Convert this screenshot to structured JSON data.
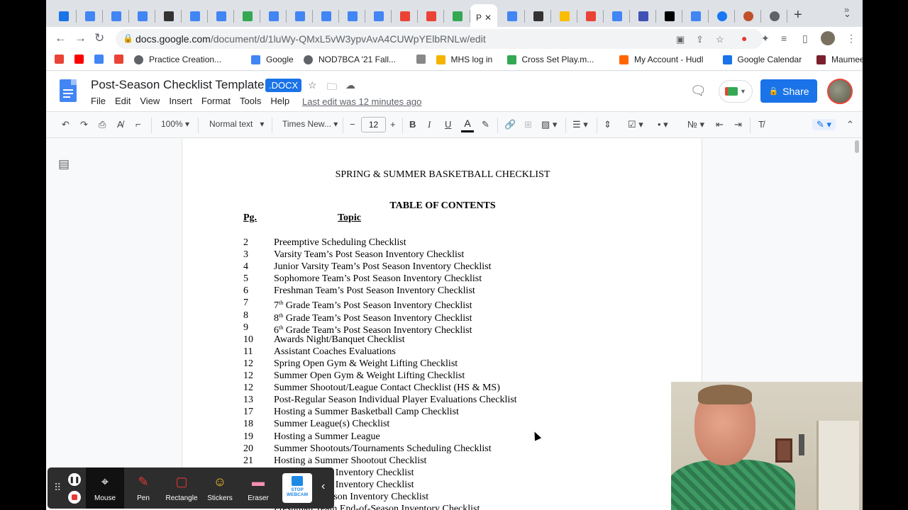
{
  "browser": {
    "tabs": [
      {
        "icon": "calendar-icon",
        "color": "#1a73e8"
      },
      {
        "icon": "docs-icon",
        "color": "#4285f4"
      },
      {
        "icon": "docs-icon",
        "color": "#4285f4"
      },
      {
        "icon": "docs-icon",
        "color": "#4285f4"
      },
      {
        "icon": "owl-icon",
        "color": "#333333"
      },
      {
        "icon": "docs-icon",
        "color": "#4285f4"
      },
      {
        "icon": "docs-icon",
        "color": "#4285f4"
      },
      {
        "icon": "drive-icon",
        "color": "#34a853"
      },
      {
        "icon": "docs-icon",
        "color": "#4285f4"
      },
      {
        "icon": "docs-icon",
        "color": "#4285f4"
      },
      {
        "icon": "docs-icon",
        "color": "#4285f4"
      },
      {
        "icon": "docs-icon",
        "color": "#4285f4"
      },
      {
        "icon": "docs-icon",
        "color": "#4285f4"
      },
      {
        "icon": "gmail-icon",
        "color": "#ea4335"
      },
      {
        "icon": "gmail-icon",
        "color": "#ea4335"
      },
      {
        "icon": "drive-icon",
        "color": "#34a853"
      }
    ],
    "active_tab": {
      "title": "P",
      "color": "#4285f4"
    },
    "tabs_after": [
      {
        "icon": "docs-icon",
        "color": "#4285f4"
      },
      {
        "icon": "b-icon",
        "color": "#333333"
      },
      {
        "icon": "photos-icon",
        "color": "#fbbc04"
      },
      {
        "icon": "gmail-icon",
        "color": "#ea4335"
      },
      {
        "icon": "docs-icon",
        "color": "#4285f4"
      },
      {
        "icon": "app-icon",
        "color": "#3f51b5"
      },
      {
        "icon": "wikipedia-icon",
        "color": "#000000"
      },
      {
        "icon": "google-icon",
        "color": "#4285f4"
      },
      {
        "icon": "facebook-icon",
        "color": "#1877f2"
      },
      {
        "icon": "basketball-icon",
        "color": "#c0502a"
      },
      {
        "icon": "chrome-icon",
        "color": "#5f6368"
      }
    ],
    "url_host": "docs.google.com",
    "url_path": "/document/d/1luWy-QMxL5vW3ypvAvA4CUWpYElbRNLw/edit",
    "bookmarks": [
      {
        "label": "",
        "icon": "app-icon",
        "color": "#ea4335"
      },
      {
        "label": "",
        "icon": "youtube-icon",
        "color": "#ff0000"
      },
      {
        "label": "",
        "icon": "google-icon",
        "color": "#4285f4"
      },
      {
        "label": "",
        "icon": "gmail-icon",
        "color": "#ea4335"
      },
      {
        "label": "Practice Creation...",
        "icon": "globe-icon",
        "color": "#5f6368"
      },
      {
        "label": "Google",
        "icon": "google-icon",
        "color": "#4285f4"
      },
      {
        "label": "NOD7BCA '21 Fall...",
        "icon": "globe-icon",
        "color": "#5f6368"
      },
      {
        "label": "",
        "icon": "app-icon",
        "color": "#888888"
      },
      {
        "label": "MHS log in",
        "icon": "app-icon",
        "color": "#f4b400"
      },
      {
        "label": "Cross Set Play.m...",
        "icon": "drive-icon",
        "color": "#34a853"
      },
      {
        "label": "My Account - Hudl",
        "icon": "hudl-icon",
        "color": "#ff6600"
      },
      {
        "label": "Google Calendar",
        "icon": "calendar-icon",
        "color": "#1a73e8"
      },
      {
        "label": "Maumee City Sch...",
        "icon": "app-icon",
        "color": "#7a1f2b"
      }
    ]
  },
  "docs": {
    "title": "Post-Season Checklist Template",
    "badge": ".DOCX",
    "menu": [
      "File",
      "Edit",
      "View",
      "Insert",
      "Format",
      "Tools",
      "Help"
    ],
    "last_edit": "Last edit was 12 minutes ago",
    "share_label": "Share",
    "toolbar": {
      "zoom": "100%",
      "style": "Normal text",
      "font": "Times New...",
      "font_size": "12"
    }
  },
  "document": {
    "heading": "SPRING & SUMMER BASKETBALL CHECKLIST",
    "toc_title": "TABLE OF CONTENTS",
    "col_pg": "Pg.",
    "col_topic": "Topic",
    "rows": [
      {
        "pg": "2",
        "pre": "Preemptive Scheduling Checklist",
        "sup": "",
        "post": ""
      },
      {
        "pg": "3",
        "pre": "Varsity Team’s Post Season Inventory Checklist",
        "sup": "",
        "post": ""
      },
      {
        "pg": "4",
        "pre": "Junior Varsity Team’s Post Season Inventory Checklist",
        "sup": "",
        "post": ""
      },
      {
        "pg": "5",
        "pre": "Sophomore Team’s Post Season Inventory Checklist",
        "sup": "",
        "post": ""
      },
      {
        "pg": "6",
        "pre": "Freshman Team’s Post Season Inventory Checklist",
        "sup": "",
        "post": ""
      },
      {
        "pg": "7",
        "pre": "7",
        "sup": "th",
        "post": " Grade Team’s Post Season Inventory Checklist"
      },
      {
        "pg": "8",
        "pre": "8",
        "sup": "th",
        "post": " Grade Team’s Post Season Inventory Checklist"
      },
      {
        "pg": "9",
        "pre": "6",
        "sup": "th",
        "post": " Grade Team’s Post Season Inventory Checklist"
      },
      {
        "pg": "10",
        "pre": "Awards Night/Banquet Checklist",
        "sup": "",
        "post": ""
      },
      {
        "pg": "11",
        "pre": "Assistant Coaches Evaluations",
        "sup": "",
        "post": ""
      },
      {
        "pg": "12",
        "pre": "Spring Open Gym & Weight Lifting Checklist",
        "sup": "",
        "post": ""
      },
      {
        "pg": "12",
        "pre": "Summer Open Gym & Weight Lifting Checklist",
        "sup": "",
        "post": ""
      },
      {
        "pg": "12",
        "pre": "Summer Shootout/League Contact Checklist (HS & MS)",
        "sup": "",
        "post": ""
      },
      {
        "pg": "13",
        "pre": "Post-Regular Season Individual Player Evaluations Checklist",
        "sup": "",
        "post": ""
      },
      {
        "pg": "17",
        "pre": "Hosting a Summer Basketball Camp Checklist",
        "sup": "",
        "post": ""
      },
      {
        "pg": "18",
        "pre": "Summer League(s) Checklist",
        "sup": "",
        "post": ""
      },
      {
        "pg": "19",
        "pre": "Hosting a Summer League",
        "sup": "",
        "post": ""
      },
      {
        "pg": "20",
        "pre": "Summer Shootouts/Tournaments Scheduling Checklist",
        "sup": "",
        "post": ""
      },
      {
        "pg": "21",
        "pre": "Hosting a Summer Shootout Checklist",
        "sup": "",
        "post": ""
      },
      {
        "pg": "",
        "pre": "End-of-Season Inventory Checklist",
        "sup": "",
        "post": ""
      },
      {
        "pg": "",
        "pre": "End-of-Season Inventory Checklist",
        "sup": "",
        "post": ""
      },
      {
        "pg": "",
        "pre": "am End-of-Season Inventory Checklist",
        "sup": "",
        "post": ""
      },
      {
        "pg": "",
        "pre": "Freshman Team End-of-Season Inventory Checklist",
        "sup": "",
        "post": ""
      }
    ]
  },
  "recorder": {
    "tools": [
      {
        "label": "Mouse",
        "icon": "mouse-icon",
        "color": "#ffffff"
      },
      {
        "label": "Pen",
        "icon": "pen-icon",
        "color": "#e53935"
      },
      {
        "label": "Rectangle",
        "icon": "rectangle-icon",
        "color": "#e53935"
      },
      {
        "label": "Stickers",
        "icon": "sticker-icon",
        "color": "#fbc02d"
      },
      {
        "label": "Eraser",
        "icon": "eraser-icon",
        "color": "#f48fb1"
      }
    ],
    "webcam_label_1": "STOP",
    "webcam_label_2": "WEBCAM"
  }
}
